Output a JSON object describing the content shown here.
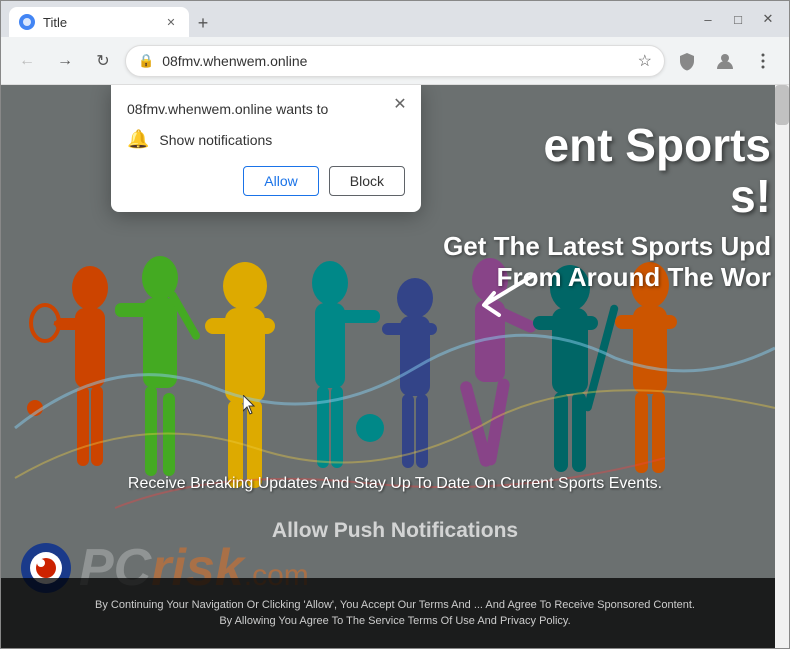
{
  "browser": {
    "tab_title": "Title",
    "url": "08fmv.whenwem.online",
    "new_tab_label": "+",
    "nav_back": "←",
    "nav_forward": "→",
    "nav_refresh": "↻"
  },
  "window_controls": {
    "minimize": "–",
    "maximize": "□",
    "close": "✕"
  },
  "popup": {
    "title": "08fmv.whenwem.online wants to",
    "permission_label": "Show notifications",
    "allow_button": "Allow",
    "block_button": "Block",
    "close_aria": "Close"
  },
  "website": {
    "headline_1": "ent Sports",
    "headline_2": "s!",
    "subtext_1": "Get The Latest Sports Upd",
    "subtext_2": "From Around The Wor",
    "bottom_text": "Receive Breaking Updates And Stay Up To Date On Current Sports Events.",
    "allow_push_text": "Allow Push Notifications",
    "banner_1": "By Continuing Your Navigation Or Clicking 'Allow', You Accept Our Terms And ... And Agree To Receive Sponsored Content.",
    "banner_2": "By Allowing You Agree To The Service Terms Of Use And Privacy Policy."
  }
}
